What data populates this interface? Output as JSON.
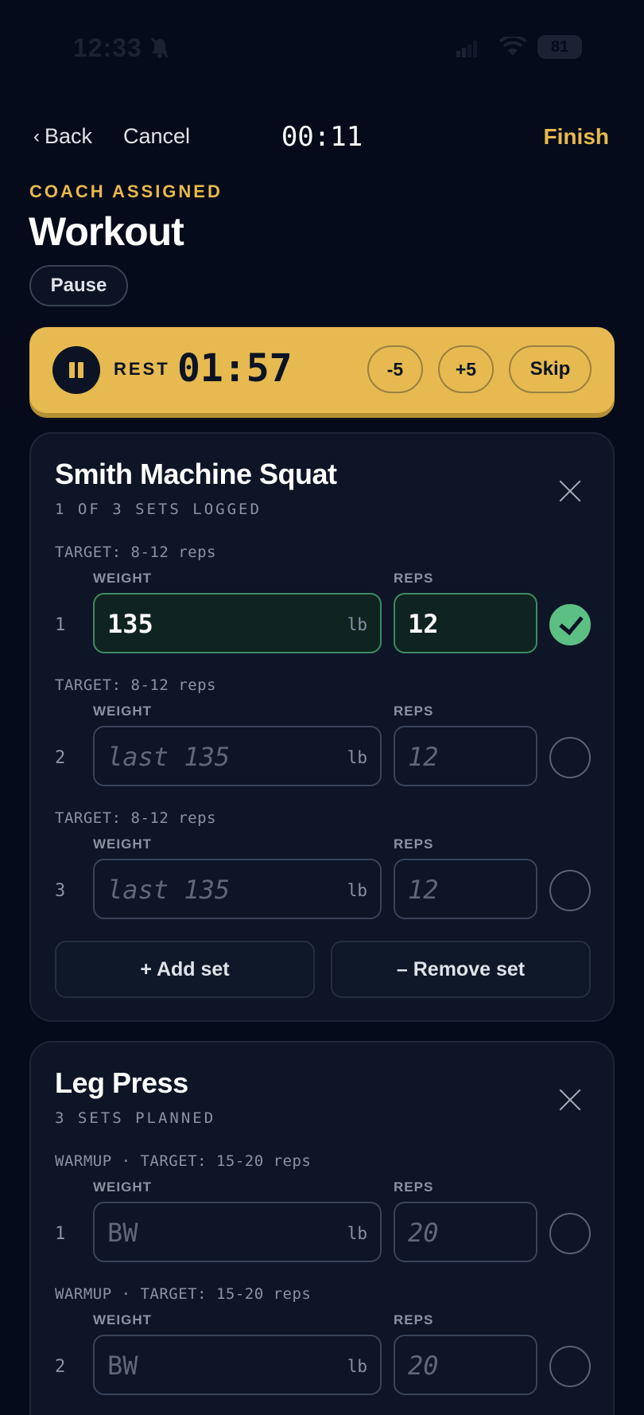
{
  "status": {
    "time": "12:33",
    "battery": "81"
  },
  "nav": {
    "back": "Back",
    "cancel": "Cancel",
    "elapsed": "00:11",
    "finish": "Finish"
  },
  "header": {
    "assigned": "COACH ASSIGNED",
    "title": "Workout",
    "pause": "Pause"
  },
  "rest": {
    "label": "REST",
    "timer": "01:57",
    "minus": "-5",
    "plus": "+5",
    "skip": "Skip"
  },
  "field_labels": {
    "weight": "WEIGHT",
    "reps": "REPS",
    "unit": "lb"
  },
  "exercises": [
    {
      "name": "Smith Machine Squat",
      "summary": "1 OF 3 SETS LOGGED",
      "sets": [
        {
          "num": "1",
          "target": "TARGET: 8-12 reps",
          "weight": "135",
          "reps": "12",
          "logged": true
        },
        {
          "num": "2",
          "target": "TARGET: 8-12 reps",
          "weight_placeholder": "last 135",
          "reps_placeholder": "12",
          "logged": false
        },
        {
          "num": "3",
          "target": "TARGET: 8-12 reps",
          "weight_placeholder": "last 135",
          "reps_placeholder": "12",
          "logged": false
        }
      ],
      "add_set": "+ Add set",
      "remove_set": "– Remove set"
    },
    {
      "name": "Leg Press",
      "summary": "3 SETS PLANNED",
      "sets": [
        {
          "num": "1",
          "target": "WARMUP · TARGET: 15-20 reps",
          "weight_placeholder": "BW",
          "reps_placeholder": "20",
          "logged": false
        },
        {
          "num": "2",
          "target": "WARMUP · TARGET: 15-20 reps",
          "weight_placeholder": "BW",
          "reps_placeholder": "20",
          "logged": false
        }
      ]
    }
  ],
  "icons": {
    "back": "chevron-left-icon",
    "close": "close-icon",
    "check": "check-icon",
    "pause": "pause-icon"
  },
  "colors": {
    "background": "#050b1a",
    "accent": "#e6ba50",
    "success": "#5cbf84",
    "card": "#0d1526"
  }
}
